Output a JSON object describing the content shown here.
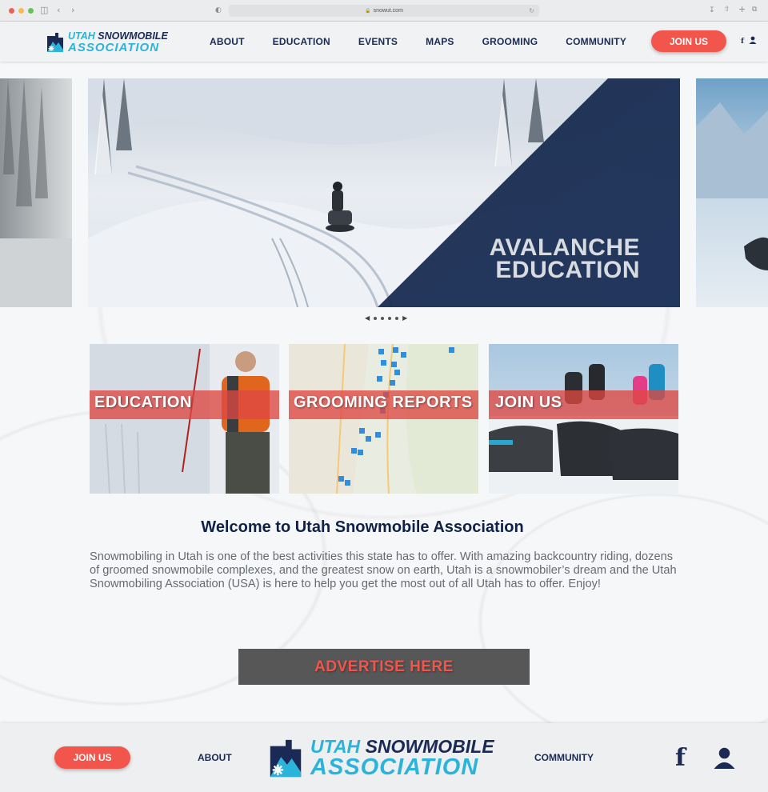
{
  "browser": {
    "url": "snowut.com"
  },
  "brand": {
    "line1_part1": "UTAH",
    "line1_part2": "SNOWMOBILE",
    "line2": "ASSOCIATION"
  },
  "nav": {
    "items": [
      "ABOUT",
      "EDUCATION",
      "EVENTS",
      "MAPS",
      "GROOMING",
      "COMMUNITY"
    ],
    "join_label": "JOIN US",
    "facebook_glyph": "f"
  },
  "hero": {
    "line1": "AVALANCHE",
    "line2": "EDUCATION"
  },
  "tiles": [
    {
      "label": "EDUCATION"
    },
    {
      "label": "GROOMING REPORTS"
    },
    {
      "label": "JOIN US"
    }
  ],
  "welcome": {
    "title": "Welcome to Utah Snowmobile Association",
    "body": "Snowmobiling in Utah is one of the best activities this state has to offer. With amazing backcountry riding, dozens of groomed snowmobile complexes, and the greatest snow on earth, Utah is a snowmobiler’s dream and the Utah Snowmobiling Association (USA) is here to help you get the most out of all Utah has to offer. Enjoy!"
  },
  "advertise": {
    "label": "ADVERTISE HERE"
  },
  "footer": {
    "join_label": "JOIN US",
    "about_label": "ABOUT",
    "community_label": "COMMUNITY",
    "facebook_glyph": "f"
  },
  "colors": {
    "navy": "#1b2a55",
    "cyan": "#2cb3d9",
    "accent_red": "#f2554c"
  }
}
